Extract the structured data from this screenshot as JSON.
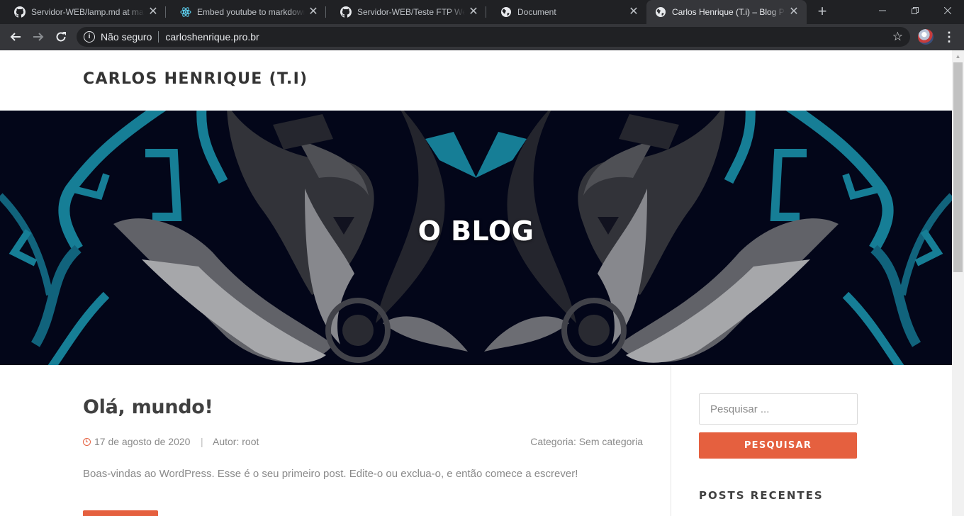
{
  "browser": {
    "tabs": [
      {
        "title": "Servidor-WEB/lamp.md at master",
        "icon": "github-icon",
        "active": false
      },
      {
        "title": "Embed youtube to markdown, GitHub",
        "icon": "react-icon",
        "active": false
      },
      {
        "title": "Servidor-WEB/Teste FTP Webmin",
        "icon": "github-icon",
        "active": false
      },
      {
        "title": "Document",
        "icon": "globe-icon",
        "active": false
      },
      {
        "title": "Carlos Henrique (T.i) – Blog Pessoal",
        "icon": "globe-icon",
        "active": true
      }
    ],
    "close_glyph": "✕",
    "new_tab_glyph": "+",
    "security_label": "Não seguro",
    "url": "carloshenrique.pro.br",
    "colors": {
      "frame": "#202124",
      "toolbar": "#35363a"
    }
  },
  "site": {
    "title": "CARLOS HENRIQUE (T.I)",
    "hero_title": "O BLOG",
    "accent_color": "#e5603f"
  },
  "post": {
    "title": "Olá, mundo!",
    "date": "17 de agosto de 2020",
    "separator": "|",
    "author": "Autor: root",
    "category": "Categoria: Sem categoria",
    "excerpt": "Boas-vindas ao WordPress. Esse é o seu primeiro post. Edite-o ou exclua-o, e então comece a escrever!"
  },
  "sidebar": {
    "search_placeholder": "Pesquisar ...",
    "search_button": "PESQUISAR",
    "recent_posts_title": "POSTS RECENTES"
  }
}
